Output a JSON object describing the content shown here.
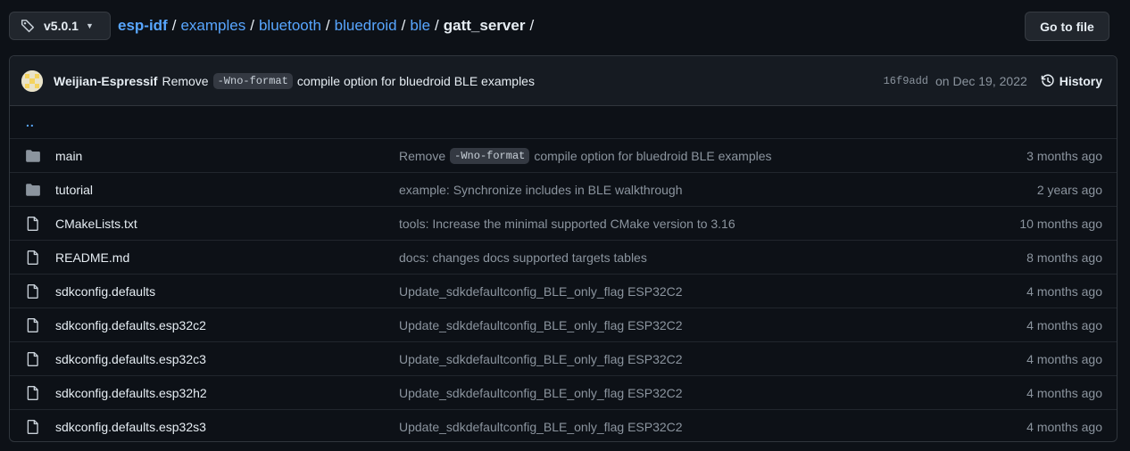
{
  "branch": {
    "label": "v5.0.1"
  },
  "breadcrumb": {
    "root": "esp-idf",
    "parts": [
      "examples",
      "bluetooth",
      "bluedroid",
      "ble"
    ],
    "current": "gatt_server",
    "separator": "/"
  },
  "goto_file": {
    "label": "Go to file"
  },
  "commit": {
    "author": "Weijian-Espressif",
    "message_before": "Remove",
    "message_code": "-Wno-format",
    "message_after": "compile option for bluedroid BLE examples",
    "sha": "16f9add",
    "date": "on Dec 19, 2022",
    "history_label": "History"
  },
  "parent_dir": {
    "label": ".."
  },
  "files": [
    {
      "type": "dir",
      "name": "main",
      "msg_before": "Remove",
      "msg_code": "-Wno-format",
      "msg_after": "compile option for bluedroid BLE examples",
      "age": "3 months ago"
    },
    {
      "type": "dir",
      "name": "tutorial",
      "msg_before": "example: Synchronize includes in BLE walkthrough",
      "age": "2 years ago"
    },
    {
      "type": "file",
      "name": "CMakeLists.txt",
      "msg_before": "tools: Increase the minimal supported CMake version to 3.16",
      "age": "10 months ago"
    },
    {
      "type": "file",
      "name": "README.md",
      "msg_before": "docs: changes docs supported targets tables",
      "age": "8 months ago"
    },
    {
      "type": "file",
      "name": "sdkconfig.defaults",
      "msg_before": "Update_sdkdefaultconfig_BLE_only_flag ESP32C2",
      "age": "4 months ago"
    },
    {
      "type": "file",
      "name": "sdkconfig.defaults.esp32c2",
      "msg_before": "Update_sdkdefaultconfig_BLE_only_flag ESP32C2",
      "age": "4 months ago"
    },
    {
      "type": "file",
      "name": "sdkconfig.defaults.esp32c3",
      "msg_before": "Update_sdkdefaultconfig_BLE_only_flag ESP32C2",
      "age": "4 months ago"
    },
    {
      "type": "file",
      "name": "sdkconfig.defaults.esp32h2",
      "msg_before": "Update_sdkdefaultconfig_BLE_only_flag ESP32C2",
      "age": "4 months ago"
    },
    {
      "type": "file",
      "name": "sdkconfig.defaults.esp32s3",
      "msg_before": "Update_sdkdefaultconfig_BLE_only_flag ESP32C2",
      "age": "4 months ago"
    }
  ],
  "icons": {
    "branch": "tag-icon",
    "caret": "caret-down-icon",
    "history": "history-icon",
    "dir": "folder-icon",
    "file": "file-icon"
  },
  "colors": {
    "link": "#58a6ff",
    "muted": "#8b949e",
    "folder": "#8b949e",
    "bg": "#0d1117"
  }
}
